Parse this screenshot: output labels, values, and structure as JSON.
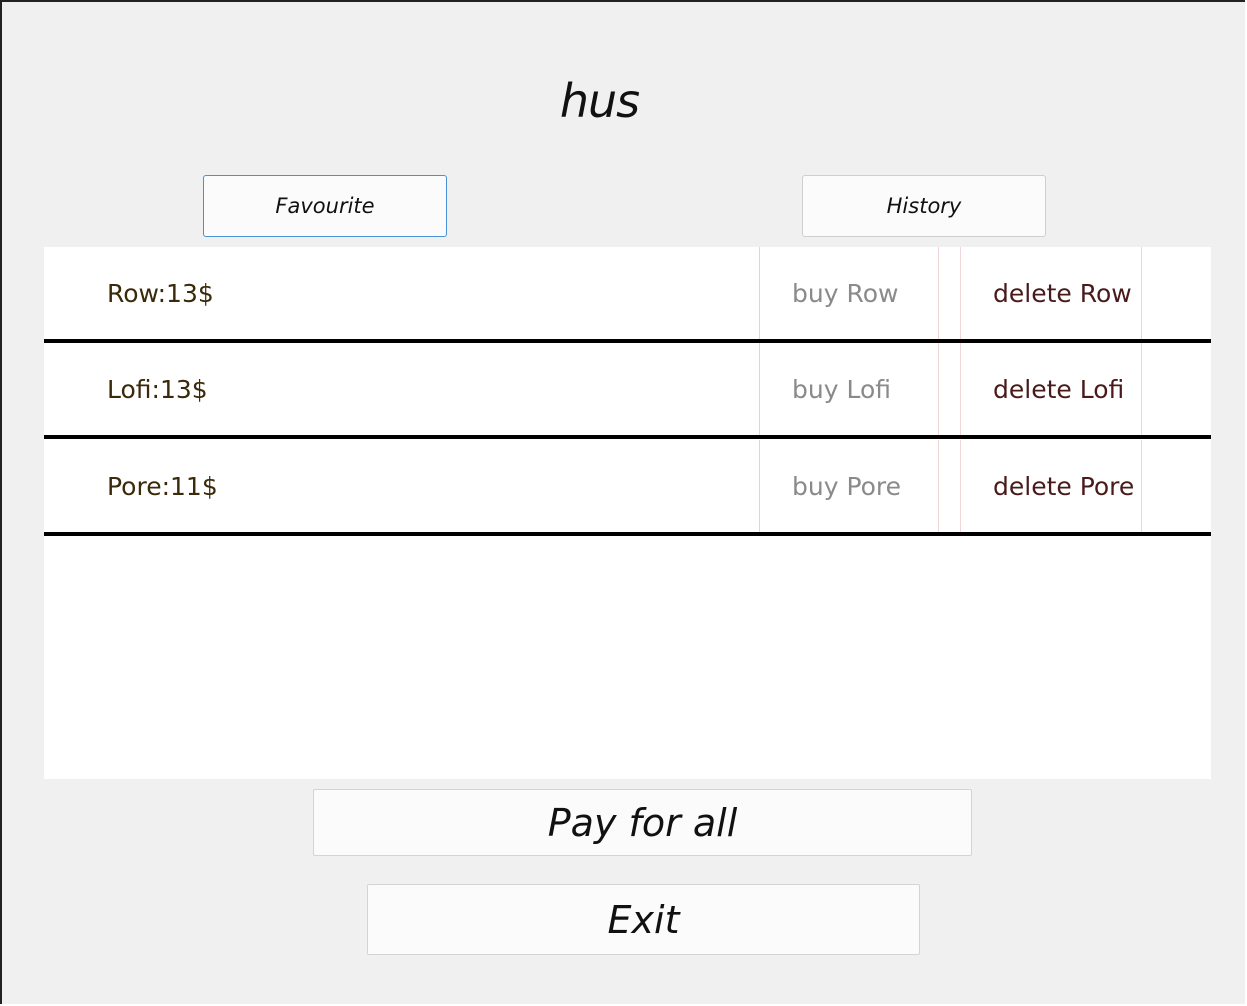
{
  "window": {
    "title": "hus"
  },
  "tabs": {
    "favourite_label": "Favourite",
    "history_label": "History"
  },
  "items": [
    {
      "label": "Row:13$",
      "buy_label": "buy Row",
      "delete_label": "delete Row"
    },
    {
      "label": "Lofi:13$",
      "buy_label": "buy Lofi",
      "delete_label": "delete Lofi"
    },
    {
      "label": "Pore:11$",
      "buy_label": "buy Pore",
      "delete_label": "delete Pore"
    }
  ],
  "actions": {
    "pay_label": "Pay for all",
    "exit_label": "Exit"
  },
  "colors": {
    "background": "#f0f0f0",
    "focus_border": "#4a90d9",
    "separator": "#000000"
  }
}
